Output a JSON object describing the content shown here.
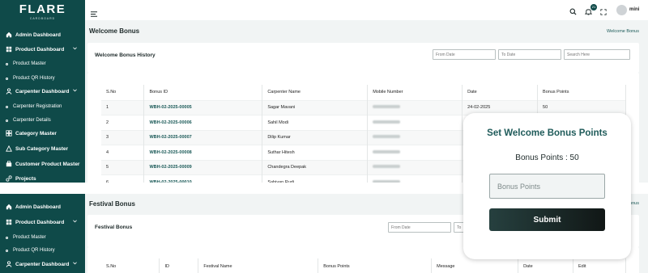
{
  "brand": {
    "logo": "FLARE",
    "tagline": "CARDBOARD"
  },
  "user": {
    "name": "mini",
    "notification_count": "21"
  },
  "sidebar": {
    "items": [
      {
        "label": "Admin Dashboard",
        "icon": "home-icon"
      },
      {
        "label": "Product Dashboard",
        "icon": "grid-icon"
      },
      {
        "label": "Product Master"
      },
      {
        "label": "Product QR History"
      },
      {
        "label": "Carpenter Dashboard",
        "icon": "user-icon"
      },
      {
        "label": "Carpenter Registration"
      },
      {
        "label": "Carpenter Details"
      },
      {
        "label": "Category Master",
        "icon": "category-icon"
      },
      {
        "label": "Sub Category Master",
        "icon": "sub-category-icon"
      },
      {
        "label": "Customer Product Master",
        "icon": "customer-icon"
      },
      {
        "label": "Projects",
        "icon": "projects-icon"
      }
    ]
  },
  "page1": {
    "title": "Welcome Bonus",
    "breadcrumb": "Welcome Bonus",
    "card_title": "Welcome Bonus History",
    "filters": {
      "from": "From Date",
      "to": "To Date",
      "search": "Search Here"
    },
    "columns": [
      "S.No",
      "Bonus ID",
      "Carpenter Name",
      "Mobile Number",
      "Date",
      "Bonus Points"
    ],
    "rows": [
      {
        "sno": "1",
        "id": "WBH-02-2025-00005",
        "name": "Sagar Mavani",
        "date": "24-02-2025",
        "points": "50"
      },
      {
        "sno": "2",
        "id": "WBH-02-2025-00006",
        "name": "Sahil Modi",
        "date": "",
        "points": ""
      },
      {
        "sno": "3",
        "id": "WBH-02-2025-00007",
        "name": "Dilip Kumar",
        "date": "",
        "points": ""
      },
      {
        "sno": "4",
        "id": "WBH-02-2025-00008",
        "name": "Suthar Hitesh",
        "date": "",
        "points": ""
      },
      {
        "sno": "5",
        "id": "WBH-02-2025-00009",
        "name": "Chandegra Deepak",
        "date": "",
        "points": ""
      },
      {
        "sno": "6",
        "id": "WBH-02-2025-00010",
        "name": "Sabiyan Rudi",
        "date": "",
        "points": ""
      }
    ]
  },
  "page2": {
    "title": "Festival Bonus",
    "breadcrumb": "Bonus",
    "card_title": "Festival Bonus",
    "filters": {
      "from": "From Date",
      "to": "To"
    },
    "columns": [
      "S.No",
      "ID",
      "Festival Name",
      "Bonus Points",
      "Message",
      "Date",
      "Edit"
    ]
  },
  "modal": {
    "title": "Set Welcome Bonus Points",
    "points_label": "Bonus Points : 50",
    "input_placeholder": "Bonus Points",
    "submit": "Submit"
  },
  "colors": {
    "sidebar": "#0f4a49",
    "accent": "#1f5b5a",
    "button": "#1b2423"
  }
}
